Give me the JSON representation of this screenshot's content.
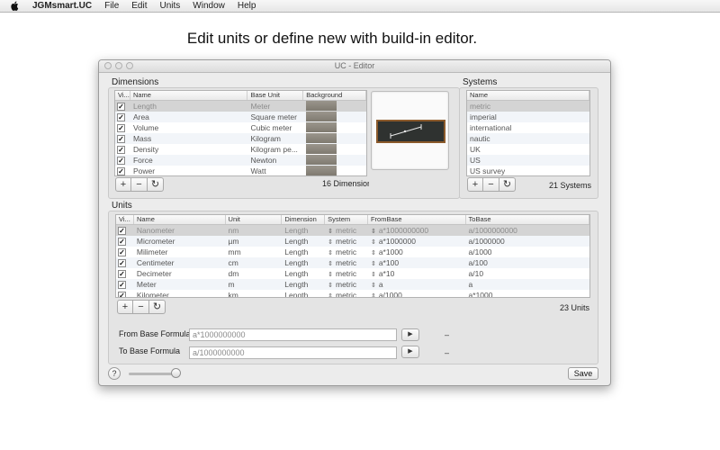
{
  "menubar": {
    "app_name": "JGMsmart.UC",
    "items": [
      "File",
      "Edit",
      "Units",
      "Window",
      "Help"
    ]
  },
  "headline": "Edit units or define new with build-in editor.",
  "window": {
    "title": "UC - Editor",
    "dimensions": {
      "label": "Dimensions",
      "columns": [
        "Vi...",
        "Name",
        "Base Unit",
        "Background"
      ],
      "rows": [
        {
          "name": "Length",
          "base_unit": "Meter"
        },
        {
          "name": "Area",
          "base_unit": "Square meter"
        },
        {
          "name": "Volume",
          "base_unit": "Cubic meter"
        },
        {
          "name": "Mass",
          "base_unit": "Kilogram"
        },
        {
          "name": "Density",
          "base_unit": "Kilogram pe..."
        },
        {
          "name": "Force",
          "base_unit": "Newton"
        },
        {
          "name": "Power",
          "base_unit": "Watt"
        }
      ],
      "count": "16 Dimensions"
    },
    "systems": {
      "label": "Systems",
      "columns": [
        "Name"
      ],
      "rows": [
        "metric",
        "imperial",
        "international",
        "nautic",
        "UK",
        "US",
        "US survey"
      ],
      "count": "21 Systems"
    },
    "units": {
      "label": "Units",
      "columns": [
        "Vi...",
        "Name",
        "Unit",
        "Dimension",
        "System",
        "FromBase",
        "ToBase"
      ],
      "rows": [
        {
          "name": "Nanometer",
          "unit": "nm",
          "dimension": "Length",
          "system": "metric",
          "from": "a*1000000000",
          "to": "a/1000000000"
        },
        {
          "name": "Micrometer",
          "unit": "µm",
          "dimension": "Length",
          "system": "metric",
          "from": "a*1000000",
          "to": "a/1000000"
        },
        {
          "name": "Milimeter",
          "unit": "mm",
          "dimension": "Length",
          "system": "metric",
          "from": "a*1000",
          "to": "a/1000"
        },
        {
          "name": "Centimeter",
          "unit": "cm",
          "dimension": "Length",
          "system": "metric",
          "from": "a*100",
          "to": "a/100"
        },
        {
          "name": "Decimeter",
          "unit": "dm",
          "dimension": "Length",
          "system": "metric",
          "from": "a*10",
          "to": "a/10"
        },
        {
          "name": "Meter",
          "unit": "m",
          "dimension": "Length",
          "system": "metric",
          "from": "a",
          "to": "a"
        },
        {
          "name": "Kilometer",
          "unit": "km",
          "dimension": "Length",
          "system": "metric",
          "from": "a/1000",
          "to": "a*1000"
        }
      ],
      "count": "23 Units"
    },
    "from_base": {
      "label": "From Base Formula",
      "value": "a*1000000000",
      "result": "–"
    },
    "to_base": {
      "label": "To Base Formula",
      "value": "a/1000000000",
      "result": "–"
    },
    "buttons": {
      "add": "+",
      "remove": "−",
      "refresh": "↻",
      "play": "▶",
      "help": "?",
      "save": "Save"
    }
  }
}
